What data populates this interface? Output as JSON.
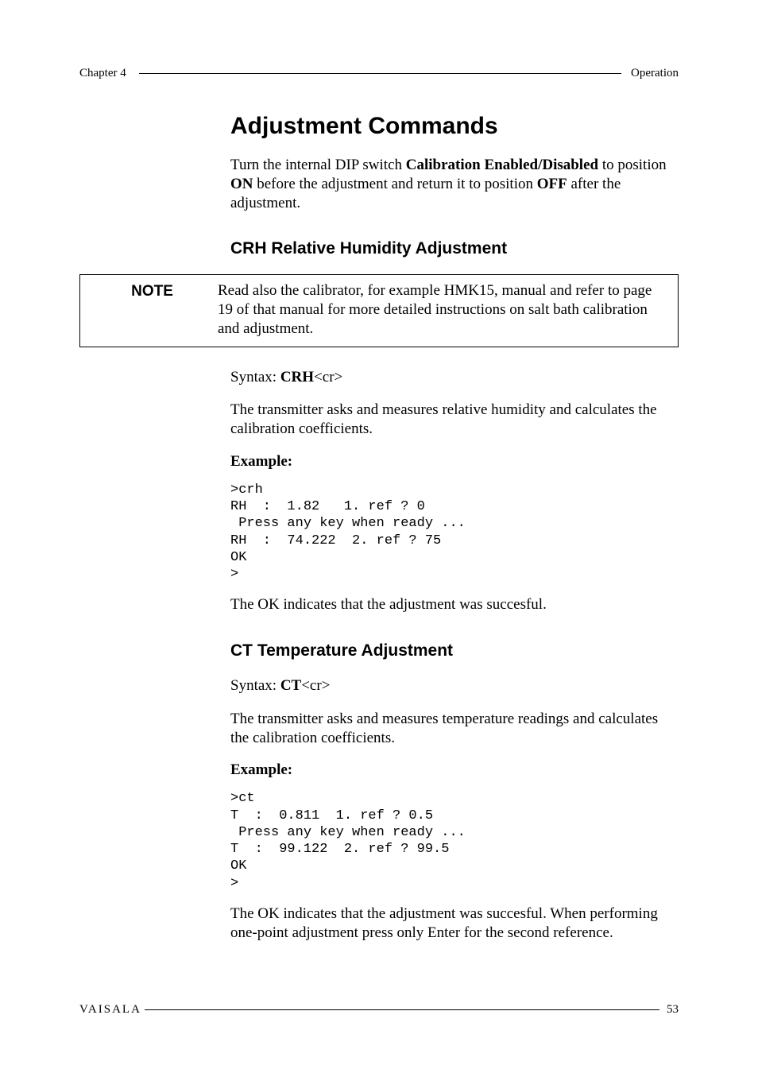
{
  "header": {
    "left": "Chapter 4",
    "right": "Operation"
  },
  "section": {
    "title": "Adjustment Commands",
    "intro_parts": {
      "a": "Turn the internal DIP switch ",
      "b": "Calibration Enabled/Disabled",
      "c": " to position ",
      "d": "ON",
      "e": " before the adjustment and return it to position ",
      "f": "OFF",
      "g": " after the adjustment."
    },
    "crh": {
      "heading": "CRH Relative Humidity Adjustment",
      "note_label": "NOTE",
      "note_text": "Read also the calibrator, for example HMK15, manual and refer to page 19 of that manual for more detailed instructions on salt bath calibration and adjustment.",
      "syntax_label": "Syntax: ",
      "syntax_cmd": "CRH",
      "syntax_tail": "<cr>",
      "desc": "The transmitter asks and measures relative humidity and calculates the calibration coefficients.",
      "example_label": "Example:",
      "code": ">crh\nRH  :  1.82   1. ref ? 0\n Press any key when ready ...\nRH  :  74.222  2. ref ? 75\nOK\n>",
      "after": "The OK indicates that the adjustment was succesful."
    },
    "ct": {
      "heading": "CT Temperature Adjustment",
      "syntax_label": "Syntax: ",
      "syntax_cmd": "CT",
      "syntax_tail": "<cr>",
      "desc": "The transmitter asks and measures temperature readings and calculates the calibration coefficients.",
      "example_label": "Example:",
      "code": ">ct\nT  :  0.811  1. ref ? 0.5\n Press any key when ready ...\nT  :  99.122  2. ref ? 99.5\nOK\n>",
      "after": "The OK indicates that the adjustment was succesful. When performing one-point adjustment press only Enter for the second reference."
    }
  },
  "footer": {
    "left": "VAISALA",
    "right": "53"
  }
}
